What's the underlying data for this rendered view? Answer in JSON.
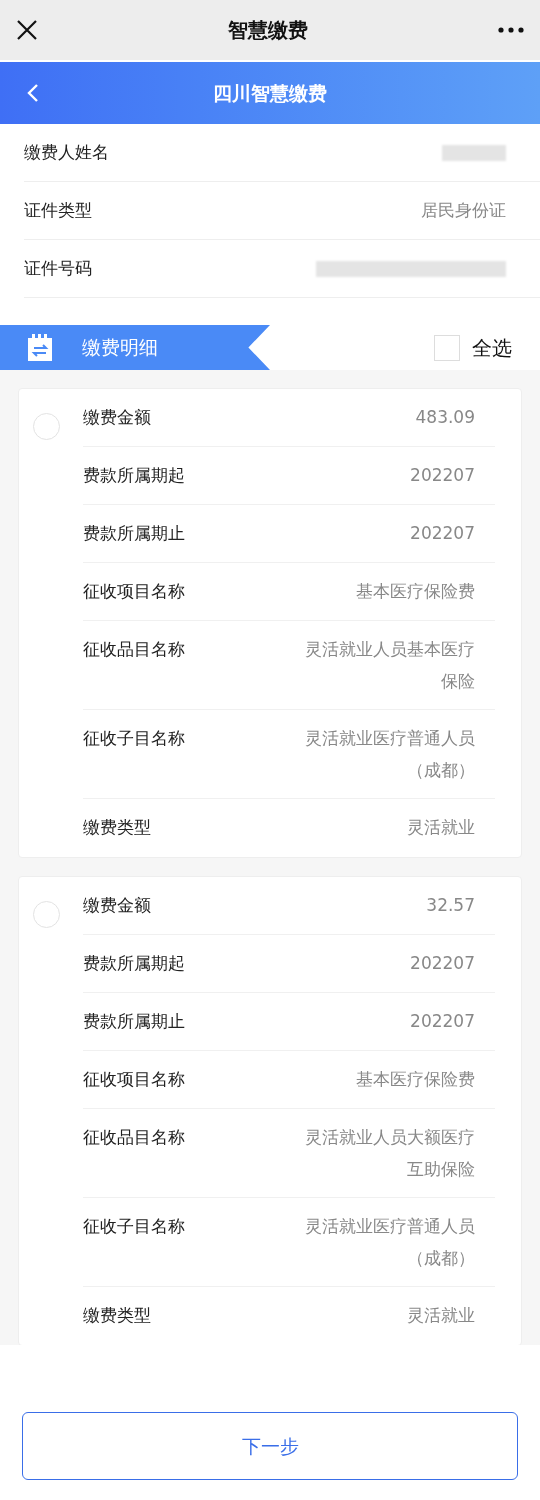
{
  "top_bar": {
    "title": "智慧缴费"
  },
  "header": {
    "title": "四川智慧缴费"
  },
  "info_rows": [
    {
      "label": "缴费人姓名",
      "value_redacted": true
    },
    {
      "label": "证件类型",
      "value": "居民身份证",
      "value_redacted": false
    },
    {
      "label": "证件号码",
      "value_redacted": true
    }
  ],
  "section": {
    "title": "缴费明细",
    "select_all": {
      "label": "全选",
      "checked": false
    }
  },
  "payments": [
    {
      "selected": false,
      "fields": [
        {
          "label": "缴费金额",
          "value": "483.09"
        },
        {
          "label": "费款所属期起",
          "value": "202207"
        },
        {
          "label": "费款所属期止",
          "value": "202207"
        },
        {
          "label": "征收项目名称",
          "value": "基本医疗保险费"
        },
        {
          "label": "征收品目名称",
          "value": "灵活就业人员基本医疗保险"
        },
        {
          "label": "征收子目名称",
          "value": "灵活就业医疗普通人员（成都）"
        },
        {
          "label": "缴费类型",
          "value": "灵活就业"
        }
      ]
    },
    {
      "selected": false,
      "fields": [
        {
          "label": "缴费金额",
          "value": "32.57"
        },
        {
          "label": "费款所属期起",
          "value": "202207"
        },
        {
          "label": "费款所属期止",
          "value": "202207"
        },
        {
          "label": "征收项目名称",
          "value": "基本医疗保险费"
        },
        {
          "label": "征收品目名称",
          "value": "灵活就业人员大额医疗互助保险"
        },
        {
          "label": "征收子目名称",
          "value": "灵活就业医疗普通人员（成都）"
        },
        {
          "label": "缴费类型",
          "value": "灵活就业"
        }
      ]
    }
  ],
  "next_button": "下一步"
}
